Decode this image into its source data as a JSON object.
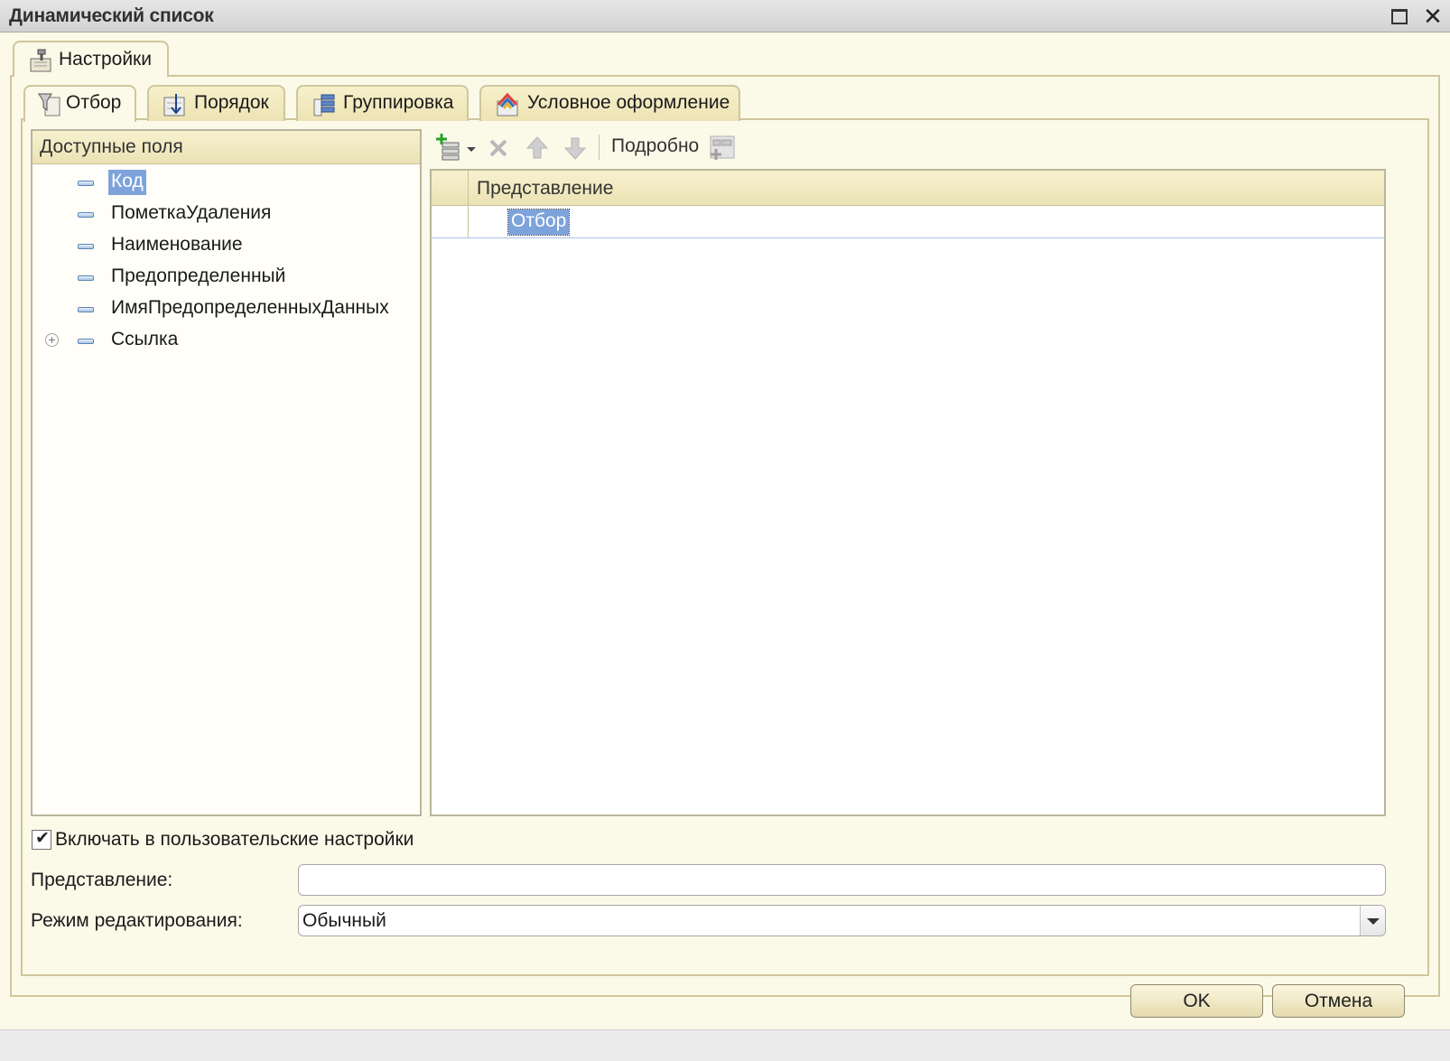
{
  "window": {
    "title": "Динамический список",
    "maximize_icon": "maximize-icon",
    "close_glyph": "✕"
  },
  "outer_tabs": [
    {
      "label": "Настройки",
      "icon": "settings-icon",
      "active": true
    }
  ],
  "inner_tabs": [
    {
      "label": "Отбор",
      "icon": "filter-icon",
      "active": true
    },
    {
      "label": "Порядок",
      "icon": "sort-icon",
      "active": false
    },
    {
      "label": "Группировка",
      "icon": "grouping-icon",
      "active": false
    },
    {
      "label": "Условное оформление",
      "icon": "conditional-format-icon",
      "active": false
    }
  ],
  "available_fields": {
    "header": "Доступные поля",
    "items": [
      {
        "label": "Код",
        "selected": true,
        "expandable": false
      },
      {
        "label": "ПометкаУдаления",
        "selected": false,
        "expandable": false
      },
      {
        "label": "Наименование",
        "selected": false,
        "expandable": false
      },
      {
        "label": "Предопределенный",
        "selected": false,
        "expandable": false
      },
      {
        "label": "ИмяПредопределенныхДанных",
        "selected": false,
        "expandable": false
      },
      {
        "label": "Ссылка",
        "selected": false,
        "expandable": true
      }
    ]
  },
  "toolbar": {
    "add_icon": "add-condition-icon",
    "delete_icon": "delete-icon",
    "up_icon": "move-up-icon",
    "down_icon": "move-down-icon",
    "details_label": "Подробно",
    "grouping_icon": "group-conditions-icon"
  },
  "filter_grid": {
    "column_header": "Представление",
    "rows": [
      {
        "label": "Отбор",
        "selected": true
      }
    ]
  },
  "include_in_user_settings": {
    "label": "Включать в пользовательские настройки",
    "checked": true
  },
  "representation": {
    "label": "Представление:",
    "value": ""
  },
  "edit_mode": {
    "label": "Режим редактирования:",
    "value": "Обычный"
  },
  "buttons": {
    "ok": "OK",
    "cancel": "Отмена"
  },
  "colors": {
    "background": "#fbf9e8",
    "tab_border": "#cfc69d",
    "selection": "#7ea3db",
    "header_gradient_top": "#f7f1cf",
    "header_gradient_bottom": "#ebe2b4"
  }
}
